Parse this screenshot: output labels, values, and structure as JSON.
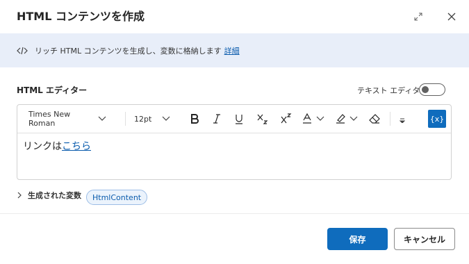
{
  "dialog": {
    "title": "HTML コンテンツを作成",
    "info_text": "リッチ HTML コンテンツを生成し、変数に格納します",
    "info_link": "詳細"
  },
  "editor": {
    "label": "HTML エディター",
    "toggle_label": "テキスト エディター",
    "toggle_on": false,
    "font_family": "Times New Roman",
    "font_size": "12pt",
    "variable_button": "{x}",
    "content_text": "リンクは",
    "content_link": "こちら"
  },
  "variables": {
    "label": "生成された変数",
    "items": [
      "HtmlContent"
    ]
  },
  "footer": {
    "save_label": "保存",
    "cancel_label": "キャンセル"
  },
  "colors": {
    "accent": "#0f6cbd",
    "banner_bg": "#e8eef9",
    "link": "#0b5cad"
  }
}
